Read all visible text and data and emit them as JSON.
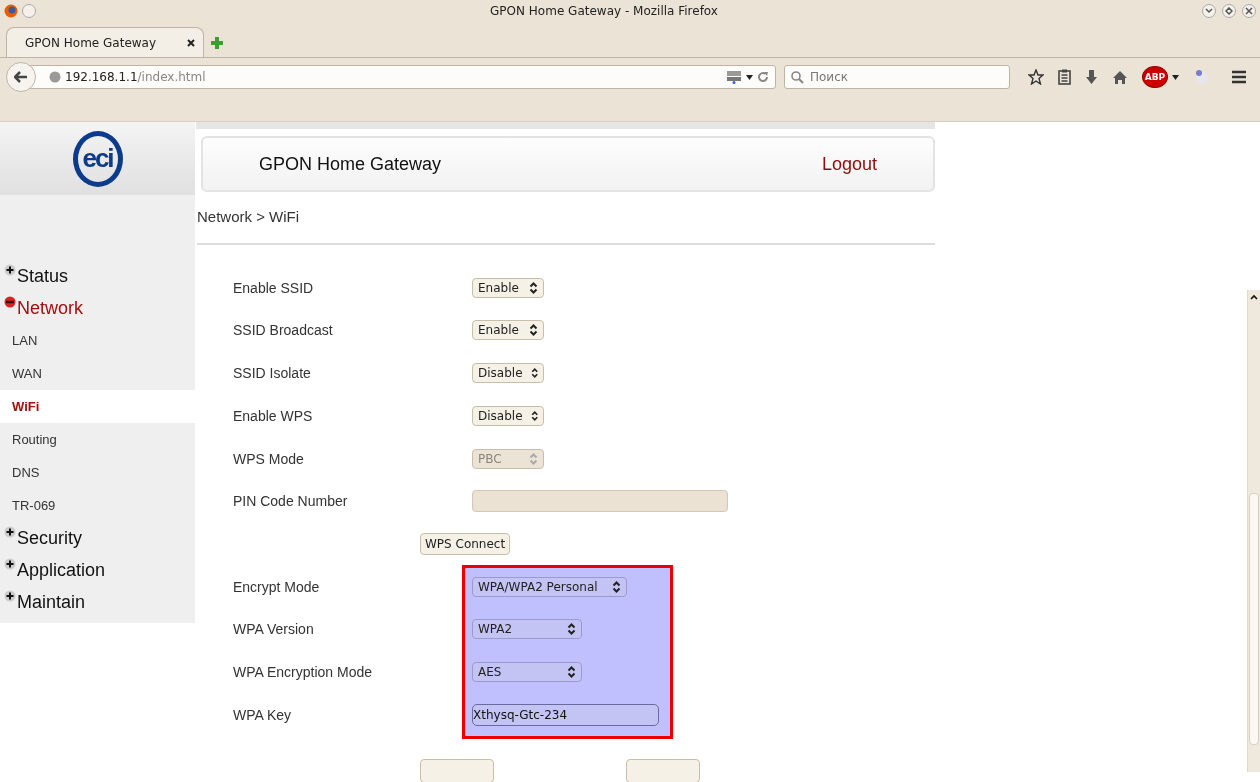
{
  "window": {
    "title": "GPON Home Gateway - Mozilla Firefox"
  },
  "tabs": [
    {
      "label": "GPON Home Gateway",
      "selected": true
    }
  ],
  "address_bar": {
    "host": "192.168.1.1",
    "path": "/index.html"
  },
  "search": {
    "placeholder": "Поиск"
  },
  "adblock_badge": "ABP",
  "logo_text": "eci",
  "header": {
    "title": "GPON Home Gateway",
    "logout": "Logout"
  },
  "breadcrumb": "Network > WiFi",
  "sidebar": {
    "items": [
      {
        "label": "Status",
        "expanded": false
      },
      {
        "label": "Network",
        "expanded": true,
        "children": [
          {
            "label": "LAN",
            "selected": false
          },
          {
            "label": "WAN",
            "selected": false
          },
          {
            "label": "WiFi",
            "selected": true
          },
          {
            "label": "Routing",
            "selected": false
          },
          {
            "label": "DNS",
            "selected": false
          },
          {
            "label": "TR-069",
            "selected": false
          }
        ]
      },
      {
        "label": "Security",
        "expanded": false
      },
      {
        "label": "Application",
        "expanded": false
      },
      {
        "label": "Maintain",
        "expanded": false
      }
    ]
  },
  "form": {
    "rows": [
      {
        "kind": "select",
        "label": "Enable SSID",
        "value": "Enable",
        "disabled": false
      },
      {
        "kind": "select",
        "label": "SSID Broadcast",
        "value": "Enable",
        "disabled": false
      },
      {
        "kind": "select",
        "label": "SSID Isolate",
        "value": "Disable",
        "disabled": false
      },
      {
        "kind": "select",
        "label": "Enable WPS",
        "value": "Disable",
        "disabled": false
      },
      {
        "kind": "select",
        "label": "WPS Mode",
        "value": "PBC",
        "disabled": true
      },
      {
        "kind": "input",
        "label": "PIN Code Number",
        "disabled": true
      },
      {
        "kind": "button",
        "label": "WPS Connect"
      }
    ],
    "highlighted_rows": [
      {
        "kind": "select",
        "label": "Encrypt Mode",
        "value": "WPA/WPA2 Personal",
        "disabled": false
      },
      {
        "kind": "select",
        "label": "WPA Version",
        "value": "WPA2",
        "disabled": false
      },
      {
        "kind": "select",
        "label": "WPA Encryption Mode",
        "value": "AES",
        "disabled": false
      },
      {
        "kind": "input",
        "label": "WPA Key",
        "value": "Xthysq-Gtc-234",
        "disabled": false
      }
    ]
  }
}
